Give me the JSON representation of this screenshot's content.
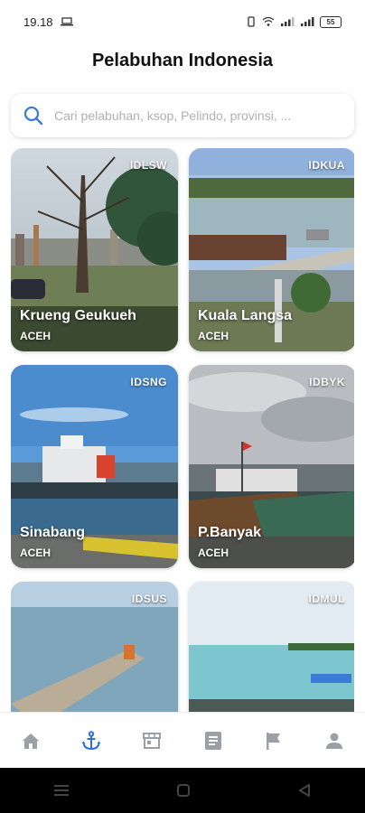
{
  "status": {
    "time": "19.18",
    "battery": "55"
  },
  "header": {
    "title": "Pelabuhan Indonesia"
  },
  "search": {
    "placeholder": "Cari pelabuhan, ksop, Pelindo, provinsi, ..."
  },
  "ports": [
    {
      "code": "IDLSW",
      "name": "Krueng Geukueh",
      "province": "ACEH"
    },
    {
      "code": "IDKUA",
      "name": "Kuala Langsa",
      "province": "ACEH"
    },
    {
      "code": "IDSNG",
      "name": "Sinabang",
      "province": "ACEH"
    },
    {
      "code": "IDBYK",
      "name": "P.Banyak",
      "province": "ACEH"
    },
    {
      "code": "IDSUS",
      "name": "",
      "province": ""
    },
    {
      "code": "IDMUL",
      "name": "",
      "province": ""
    }
  ],
  "nav": {
    "items": [
      "home-icon",
      "anchor-icon",
      "store-icon",
      "document-icon",
      "flag-icon",
      "user-icon"
    ],
    "active": "anchor-icon",
    "active_color": "#2f6fd6",
    "inactive_color": "#9aa0a6"
  }
}
